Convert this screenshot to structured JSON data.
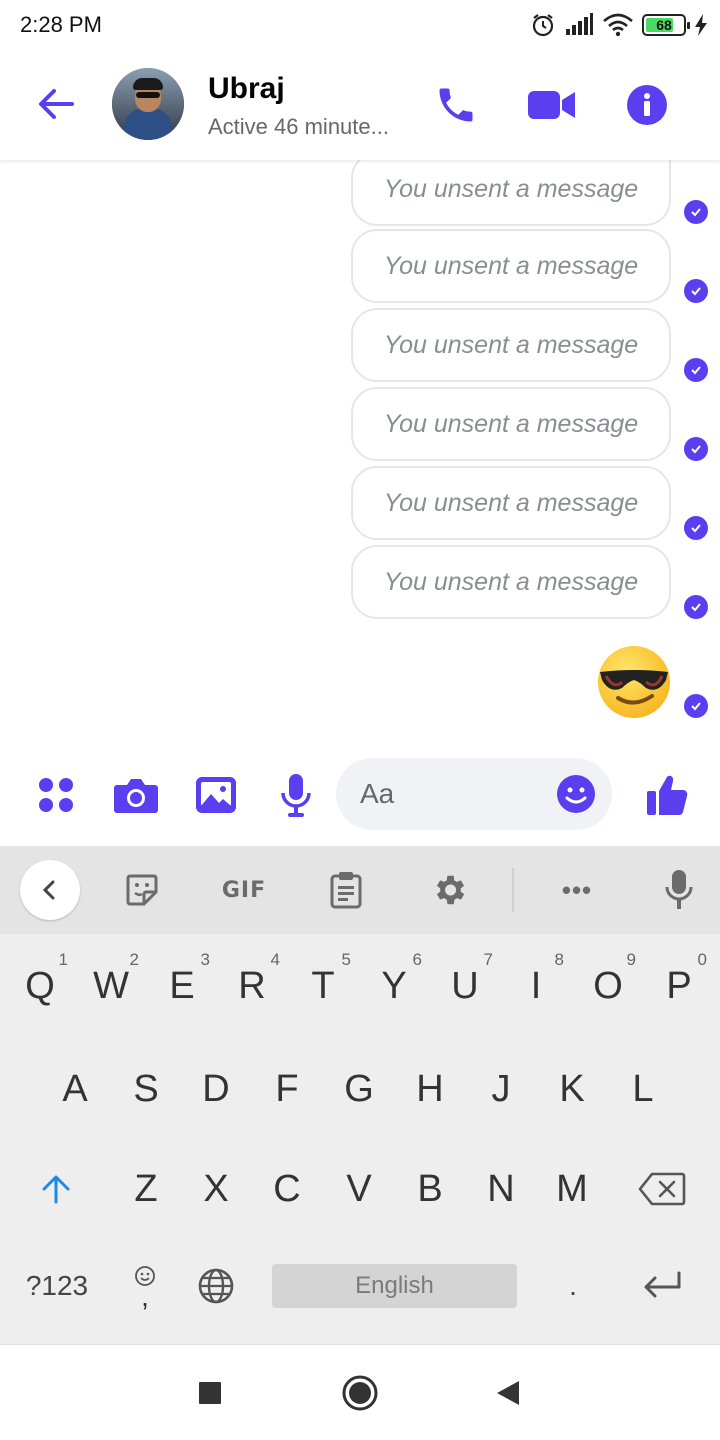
{
  "status_bar": {
    "time": "2:28 PM",
    "battery": "68",
    "icons": [
      "alarm-icon",
      "signal-icon",
      "wifi-icon",
      "battery-icon",
      "charging-icon"
    ]
  },
  "header": {
    "contact_name": "Ubraj",
    "contact_status": "Active 46 minute...",
    "accent_color": "#5b3ef0",
    "icons": [
      "back-arrow-icon",
      "phone-icon",
      "video-camera-icon",
      "info-icon"
    ]
  },
  "messages": [
    {
      "text": "You unsent a message",
      "status": "seen"
    },
    {
      "text": "You unsent a message",
      "status": "seen"
    },
    {
      "text": "You unsent a message",
      "status": "seen"
    },
    {
      "text": "You unsent a message",
      "status": "seen"
    },
    {
      "text": "You unsent a message",
      "status": "seen"
    },
    {
      "text": "You unsent a message",
      "status": "seen"
    },
    {
      "emoji": "sunglasses-emoji",
      "status": "seen"
    }
  ],
  "composer": {
    "placeholder": "Aa",
    "icons": [
      "apps-icon",
      "camera-icon",
      "gallery-icon",
      "microphone-icon",
      "emoji-icon",
      "thumbs-up-icon"
    ]
  },
  "keyboard": {
    "toolbar": {
      "gif_label": "GIF",
      "more_label": "•••",
      "icons": [
        "chevron-left-icon",
        "sticker-icon",
        "clipboard-icon",
        "settings-icon",
        "voice-input-icon"
      ]
    },
    "row1": [
      {
        "key": "Q",
        "hint": "1"
      },
      {
        "key": "W",
        "hint": "2"
      },
      {
        "key": "E",
        "hint": "3"
      },
      {
        "key": "R",
        "hint": "4"
      },
      {
        "key": "T",
        "hint": "5"
      },
      {
        "key": "Y",
        "hint": "6"
      },
      {
        "key": "U",
        "hint": "7"
      },
      {
        "key": "I",
        "hint": "8"
      },
      {
        "key": "O",
        "hint": "9"
      },
      {
        "key": "P",
        "hint": "0"
      }
    ],
    "row2": [
      "A",
      "S",
      "D",
      "F",
      "G",
      "H",
      "J",
      "K",
      "L"
    ],
    "row3": [
      "Z",
      "X",
      "C",
      "V",
      "B",
      "N",
      "M"
    ],
    "symbols_label": "?123",
    "comma_label": ",",
    "space_label": "English",
    "period_label": "."
  },
  "navbar": {
    "icons": [
      "recents-square-icon",
      "home-circle-icon",
      "back-triangle-icon"
    ]
  }
}
